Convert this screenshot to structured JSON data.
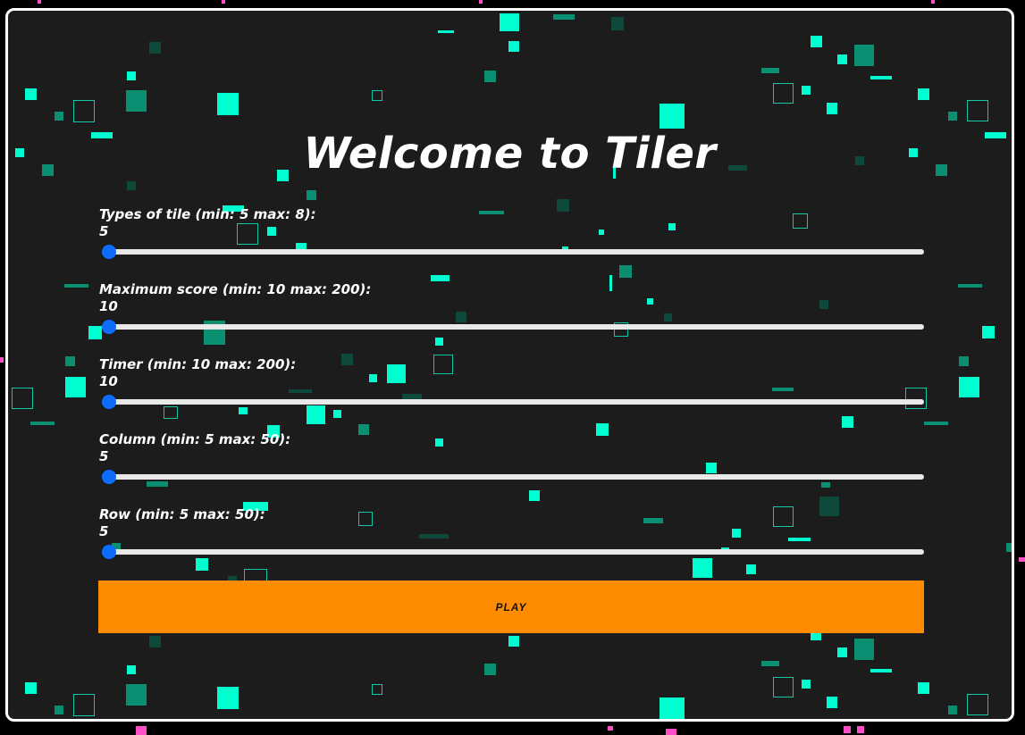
{
  "app": {
    "title": "Welcome to Tiler"
  },
  "settings": [
    {
      "label": "Types of tile (min: 5 max: 8):",
      "value": "5",
      "min": 5,
      "max": 8,
      "current": 5
    },
    {
      "label": "Maximum score (min: 10 max: 200):",
      "value": "10",
      "min": 10,
      "max": 200,
      "current": 10
    },
    {
      "label": "Timer (min: 10 max: 200):",
      "value": "10",
      "min": 10,
      "max": 200,
      "current": 10
    },
    {
      "label": "Column (min: 5 max: 50):",
      "value": "5",
      "min": 5,
      "max": 50,
      "current": 5
    },
    {
      "label": "Row (min: 5 max: 50):",
      "value": "5",
      "min": 5,
      "max": 50,
      "current": 5
    }
  ],
  "play_button": {
    "label": "PLAY"
  },
  "colors": {
    "background": "#1c1c1c",
    "tile_bright": "#00ffd0",
    "tile_mid": "#0a8f72",
    "tile_dark": "#0e4a3c",
    "button": "#ff8c00",
    "slider_thumb": "#0d6efd",
    "frame_border": "#ffffff"
  }
}
